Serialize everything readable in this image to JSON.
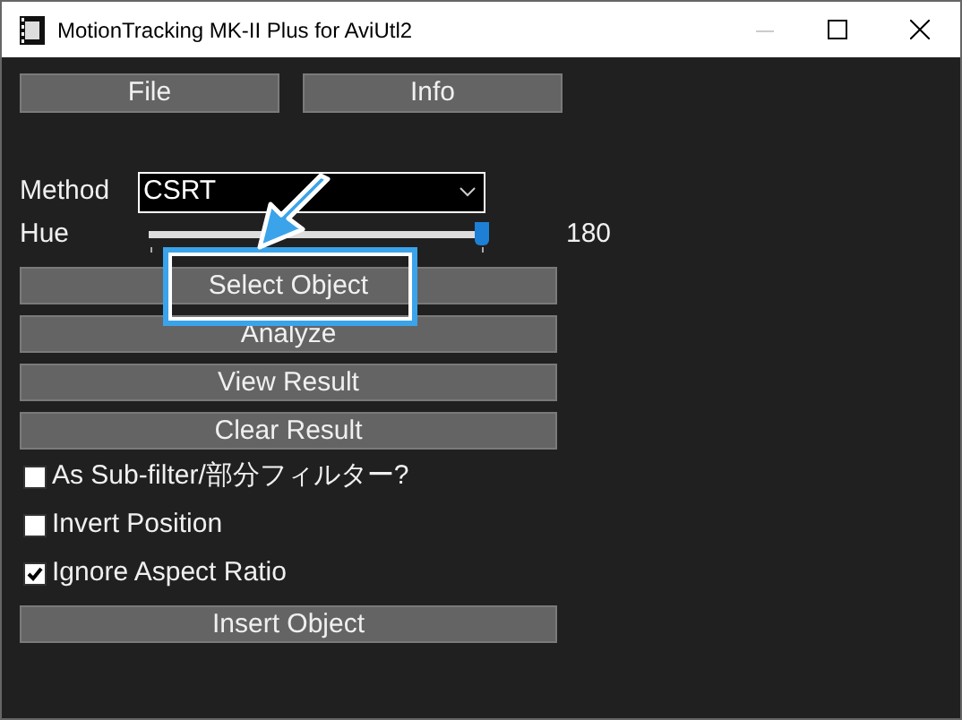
{
  "window": {
    "title": "MotionTracking MK-II Plus for AviUtl2"
  },
  "top_buttons": [
    "File",
    "Info"
  ],
  "method": {
    "label": "Method",
    "value": "CSRT"
  },
  "hue": {
    "label": "Hue",
    "level": 1,
    "reading": "180"
  },
  "items": [
    {
      "kind": "button",
      "label": "Select Object",
      "highlighted": true
    },
    {
      "kind": "button",
      "label": "Analyze",
      "highlighted": false
    },
    {
      "kind": "button",
      "label": "View Result",
      "highlighted": false
    },
    {
      "kind": "button",
      "label": "Clear Result",
      "highlighted": false
    },
    {
      "kind": "checkbox",
      "label": "As Sub-filter/部分フィルター?",
      "checked": false
    },
    {
      "kind": "checkbox",
      "label": "Invert Position",
      "checked": false
    },
    {
      "kind": "checkbox",
      "label": "Ignore Aspect Ratio",
      "checked": true
    },
    {
      "kind": "button",
      "label": "Insert Object",
      "highlighted": false
    }
  ]
}
